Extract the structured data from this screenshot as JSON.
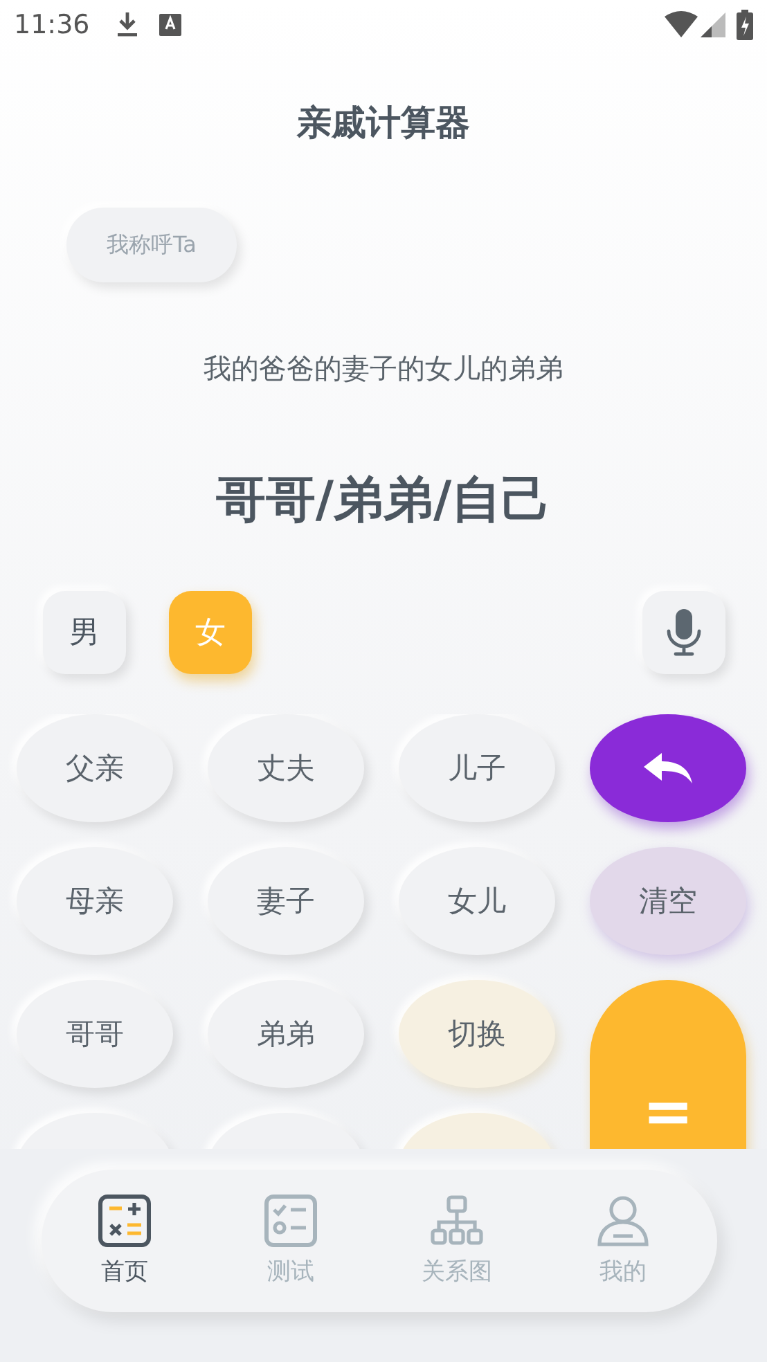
{
  "status_bar": {
    "time": "11:36"
  },
  "title": "亲戚计算器",
  "call_me_button": "我称呼Ta",
  "relation": "我的爸爸的妻子的女儿的弟弟",
  "result": "哥哥/弟弟/自己",
  "gender": [
    {
      "label": "男",
      "selected": false
    },
    {
      "label": "女",
      "selected": true
    }
  ],
  "keys": [
    {
      "kind": "normal",
      "label": "父亲"
    },
    {
      "kind": "normal",
      "label": "丈夫"
    },
    {
      "kind": "normal",
      "label": "儿子"
    },
    {
      "kind": "back"
    },
    {
      "kind": "normal",
      "label": "母亲"
    },
    {
      "kind": "normal",
      "label": "妻子"
    },
    {
      "kind": "normal",
      "label": "女儿"
    },
    {
      "kind": "clear",
      "label": "清空"
    },
    {
      "kind": "normal",
      "label": "哥哥"
    },
    {
      "kind": "normal",
      "label": "弟弟"
    },
    {
      "kind": "switch",
      "label": "切换"
    },
    {
      "kind": "equals",
      "label": "="
    },
    {
      "kind": "normal"
    },
    {
      "kind": "normal"
    },
    {
      "kind": "switch"
    }
  ],
  "tabs": [
    {
      "label": "首页",
      "kind": "calculator",
      "selected": true
    },
    {
      "label": "测试",
      "kind": "checklist",
      "selected": false
    },
    {
      "label": "关系图",
      "kind": "hierarchy",
      "selected": false
    },
    {
      "label": "我的",
      "kind": "person",
      "selected": false
    }
  ]
}
